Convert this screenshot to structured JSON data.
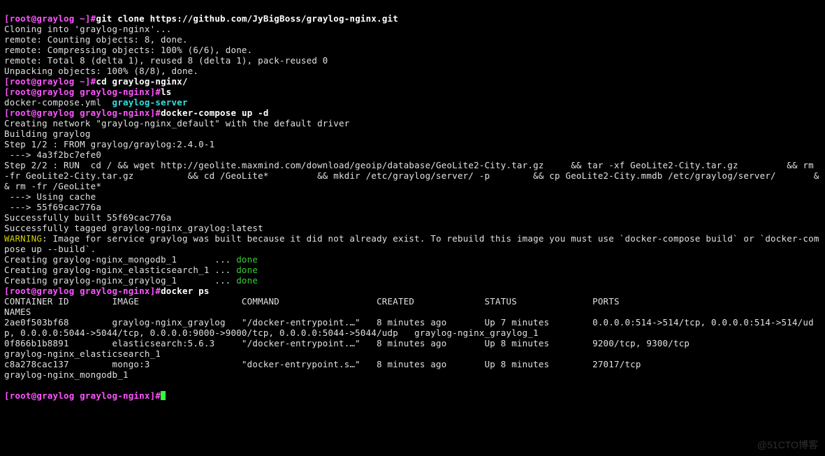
{
  "prompt1": {
    "bracket_l": "[",
    "user_host": "root@graylog",
    "path": " ~",
    "bracket_r": "]#",
    "cmd": "git clone https://github.com/JyBigBoss/graylog-nginx.git"
  },
  "clone": {
    "l1": "Cloning into 'graylog-nginx'...",
    "l2": "remote: Counting objects: 8, done.",
    "l3": "remote: Compressing objects: 100% (6/6), done.",
    "l4": "remote: Total 8 (delta 1), reused 8 (delta 1), pack-reused 0",
    "l5": "Unpacking objects: 100% (8/8), done."
  },
  "prompt2": {
    "bracket_l": "[",
    "user_host": "root@graylog",
    "path": " ~",
    "bracket_r": "]#",
    "cmd": "cd graylog-nginx/"
  },
  "prompt3": {
    "bracket_l": "[",
    "user_host": "root@graylog",
    "path": " graylog-nginx",
    "bracket_r": "]#",
    "cmd": "ls"
  },
  "ls": {
    "file1": "docker-compose.yml",
    "sep": "  ",
    "dir1": "graylog-server"
  },
  "prompt4": {
    "bracket_l": "[",
    "user_host": "root@graylog",
    "path": " graylog-nginx",
    "bracket_r": "]#",
    "cmd": "docker-compose up -d"
  },
  "up": {
    "l1": "Creating network \"graylog-nginx_default\" with the default driver",
    "l2": "Building graylog",
    "l3": "Step 1/2 : FROM graylog/graylog:2.4.0-1",
    "l4": " ---> 4a3f2bc7efe0",
    "l5": "Step 2/2 : RUN  cd / && wget http://geolite.maxmind.com/download/geoip/database/GeoLite2-City.tar.gz     && tar -xf GeoLite2-City.tar.gz         && rm -fr GeoLite2-City.tar.gz          && cd /GeoLite*         && mkdir /etc/graylog/server/ -p        && cp GeoLite2-City.mmdb /etc/graylog/server/       && rm -fr /GeoLite*",
    "l6": " ---> Using cache",
    "l7": " ---> 55f69cac776a",
    "l8": "Successfully built 55f69cac776a",
    "l9": "Successfully tagged graylog-nginx_graylog:latest",
    "warn_tag": "WARNING",
    "warn_msg": ": Image for service graylog was built because it did not already exist. To rebuild this image you must use `docker-compose build` or `docker-compose up --build`.",
    "c1a": "Creating graylog-nginx_mongodb_1       ... ",
    "c1b": "done",
    "c2a": "Creating graylog-nginx_elasticsearch_1 ... ",
    "c2b": "done",
    "c3a": "Creating graylog-nginx_graylog_1       ... ",
    "c3b": "done"
  },
  "prompt5": {
    "bracket_l": "[",
    "user_host": "root@graylog",
    "path": " graylog-nginx",
    "bracket_r": "]#",
    "cmd": "docker ps"
  },
  "ps": {
    "hdr": "CONTAINER ID        IMAGE                   COMMAND                  CREATED             STATUS              PORTS                                                                                                                                NAMES",
    "r1": "2ae0f503bf68        graylog-nginx_graylog   \"/docker-entrypoint.…\"   8 minutes ago       Up 7 minutes        0.0.0.0:514->514/tcp, 0.0.0.0:514->514/udp, 0.0.0.0:5044->5044/tcp, 0.0.0.0:9000->9000/tcp, 0.0.0.0:5044->5044/udp   graylog-nginx_graylog_1",
    "r2": "0f866b1b8891        elasticsearch:5.6.3     \"/docker-entrypoint.…\"   8 minutes ago       Up 8 minutes        9200/tcp, 9300/tcp                                                                                                    graylog-nginx_elasticsearch_1",
    "r3": "c8a278cac137        mongo:3                 \"docker-entrypoint.s…\"   8 minutes ago       Up 8 minutes        27017/tcp                                                                                                             graylog-nginx_mongodb_1"
  },
  "prompt6": {
    "bracket_l": "[",
    "user_host": "root@graylog",
    "path": " graylog-nginx",
    "bracket_r": "]#"
  },
  "watermark": "@51CTO博客"
}
